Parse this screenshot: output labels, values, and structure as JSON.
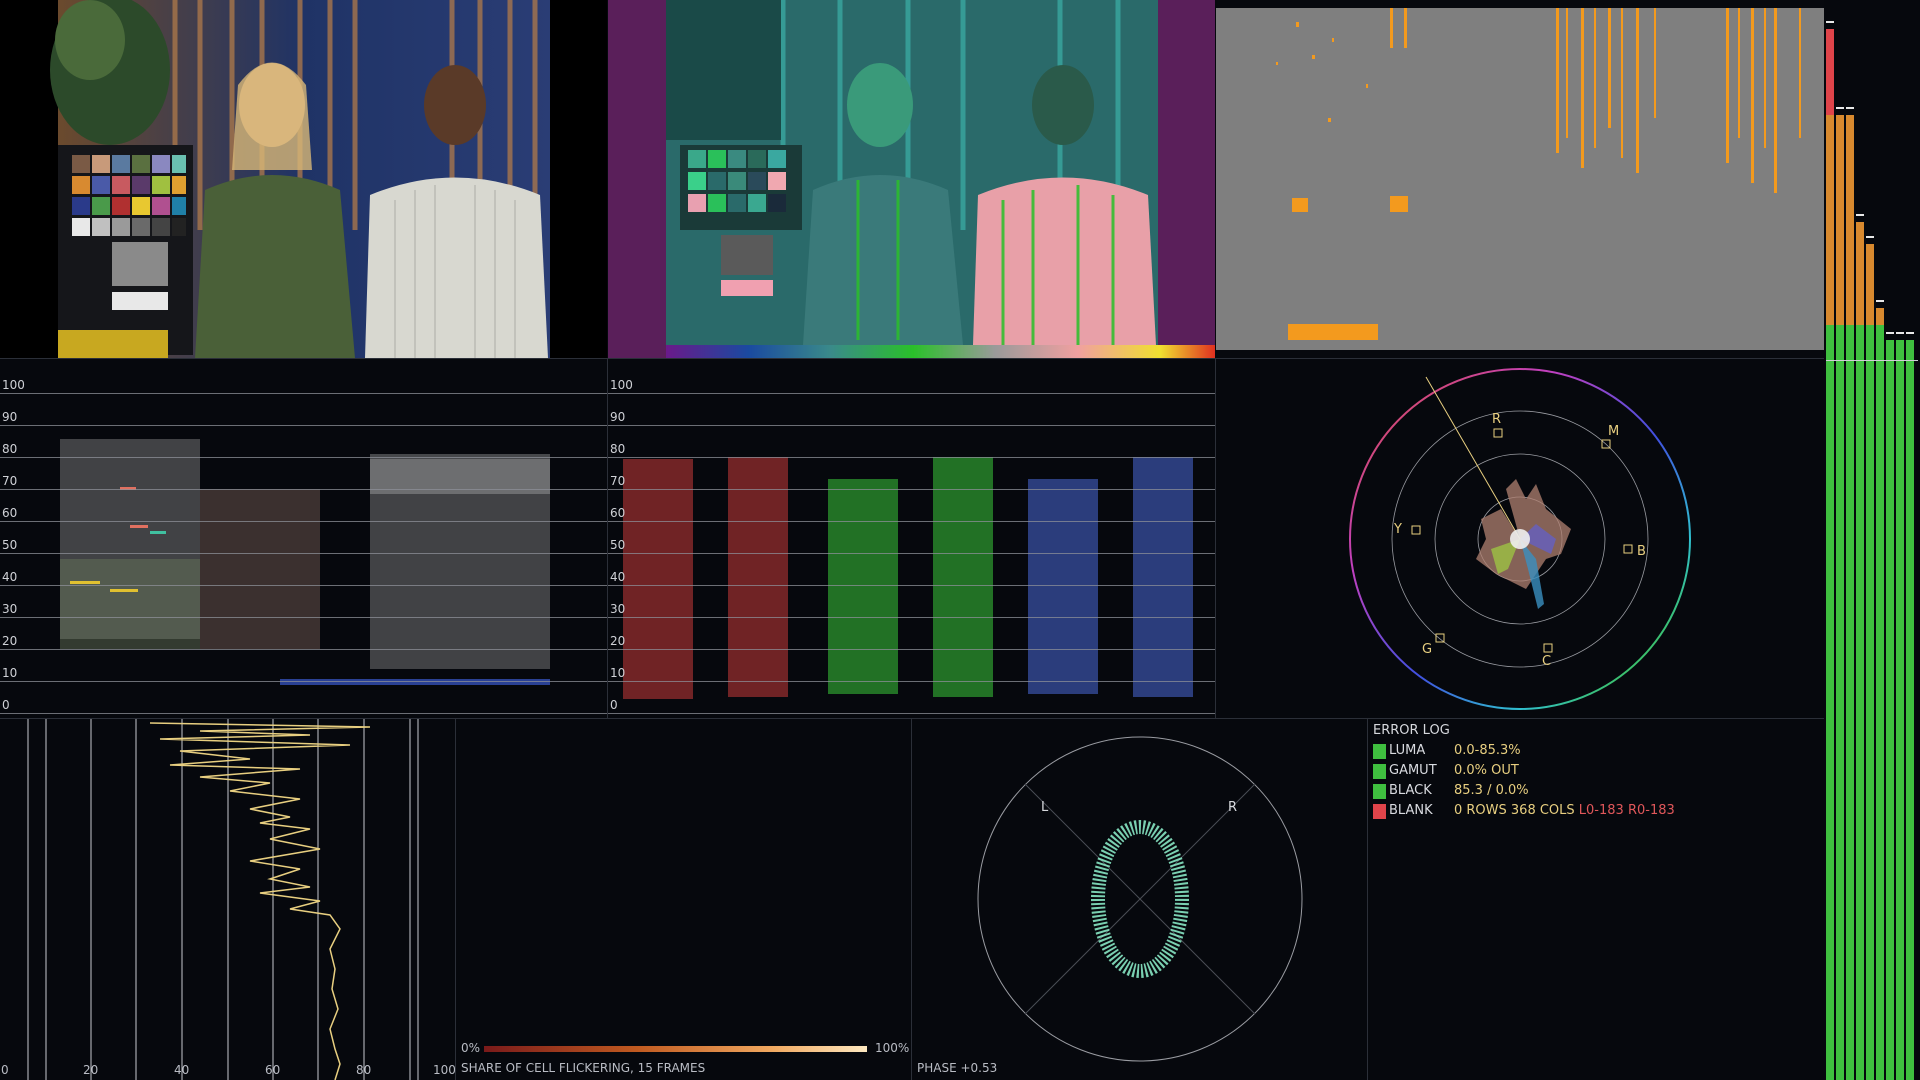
{
  "colors": {
    "bg": "#06080d",
    "accent_orange": "#f39a1e",
    "accent_yellow": "#e8cf80",
    "ok_green": "#3fbf3f",
    "error_red": "#e0444a",
    "vector_green": "#8ff3cf"
  },
  "waveform_luma": {
    "scale": [
      "100",
      "90",
      "80",
      "70",
      "60",
      "50",
      "40",
      "30",
      "20",
      "10",
      "0"
    ]
  },
  "waveform_rgb": {
    "scale": [
      "100",
      "90",
      "80",
      "70",
      "60",
      "50",
      "40",
      "30",
      "20",
      "10",
      "0"
    ]
  },
  "vectorscope": {
    "targets": [
      "R",
      "M",
      "B",
      "C",
      "G",
      "Y"
    ]
  },
  "histogram": {
    "ticks": [
      "0",
      "20",
      "40",
      "60",
      "80",
      "100"
    ]
  },
  "flicker": {
    "start_label": "0%",
    "end_label": "100%",
    "caption": "SHARE OF CELL FLICKERING, 15 FRAMES"
  },
  "phase": {
    "left_label": "L",
    "right_label": "R",
    "caption": "PHASE +0.53"
  },
  "error_log": {
    "title": "ERROR LOG",
    "rows": [
      {
        "key": "LUMA",
        "value": "0.0-85.3%",
        "extra": "",
        "status": "#3fbf3f"
      },
      {
        "key": "GAMUT",
        "value": "0.0% OUT",
        "extra": "",
        "status": "#3fbf3f"
      },
      {
        "key": "BLACK",
        "value": "85.3 / 0.0%",
        "extra": "",
        "status": "#3fbf3f"
      },
      {
        "key": "BLANK",
        "value": "0 ROWS 368 COLS",
        "extra": "L0-183 R0-183",
        "status": "#e0444a"
      }
    ]
  },
  "meters": {
    "levels": [
      0.98,
      0.9,
      0.9,
      0.8,
      0.78,
      0.72,
      0.69,
      0.69,
      0.69
    ]
  },
  "images": {
    "source": "source-video-frame",
    "false_color": "false-color-frame",
    "gamut": "gamut-error-map"
  }
}
